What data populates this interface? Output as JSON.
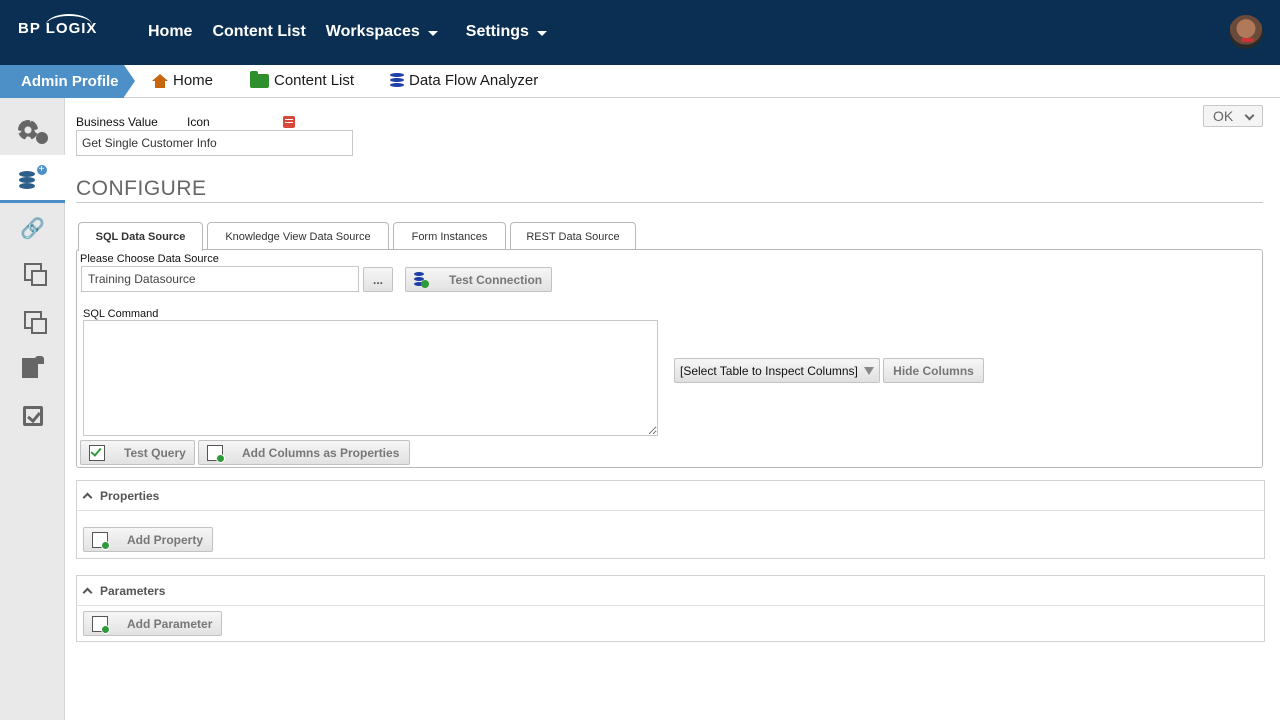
{
  "topnav": {
    "logo": "BP LOGIX",
    "items": [
      "Home",
      "Content List",
      "Workspaces",
      "Settings"
    ]
  },
  "breadcrumb": {
    "profile": "Admin Profile",
    "items": [
      "Home",
      "Content List",
      "Data Flow Analyzer"
    ]
  },
  "sidebar": {
    "icons": [
      "gears-icon",
      "database-add-icon",
      "link-icon",
      "squares-icon",
      "copy-icon",
      "document-lock-icon",
      "checkbox-icon"
    ]
  },
  "form": {
    "business_value_label": "Business Value",
    "icon_label": "Icon",
    "business_value": "Get Single Customer Info",
    "ok_label": "OK",
    "configure_heading": "CONFIGURE"
  },
  "tabs": [
    "SQL Data Source",
    "Knowledge View Data Source",
    "Form Instances",
    "REST Data Source"
  ],
  "sql": {
    "choose_label": "Please Choose Data Source",
    "data_source_value": "Training Datasource",
    "browse_label": "...",
    "test_connection_label": "Test Connection",
    "sql_command_label": "SQL Command",
    "sql_command_value": "",
    "table_select_value": "[Select Table to Inspect Columns]",
    "hide_columns_label": "Hide Columns",
    "test_query_label": "Test Query",
    "add_columns_label": "Add Columns as Properties"
  },
  "properties": {
    "title": "Properties",
    "add_label": "Add Property"
  },
  "parameters": {
    "title": "Parameters",
    "add_label": "Add Parameter"
  },
  "colors": {
    "topbar": "#0b2f52",
    "accent": "#4d90c8",
    "sidebar": "#e9e9e9"
  }
}
